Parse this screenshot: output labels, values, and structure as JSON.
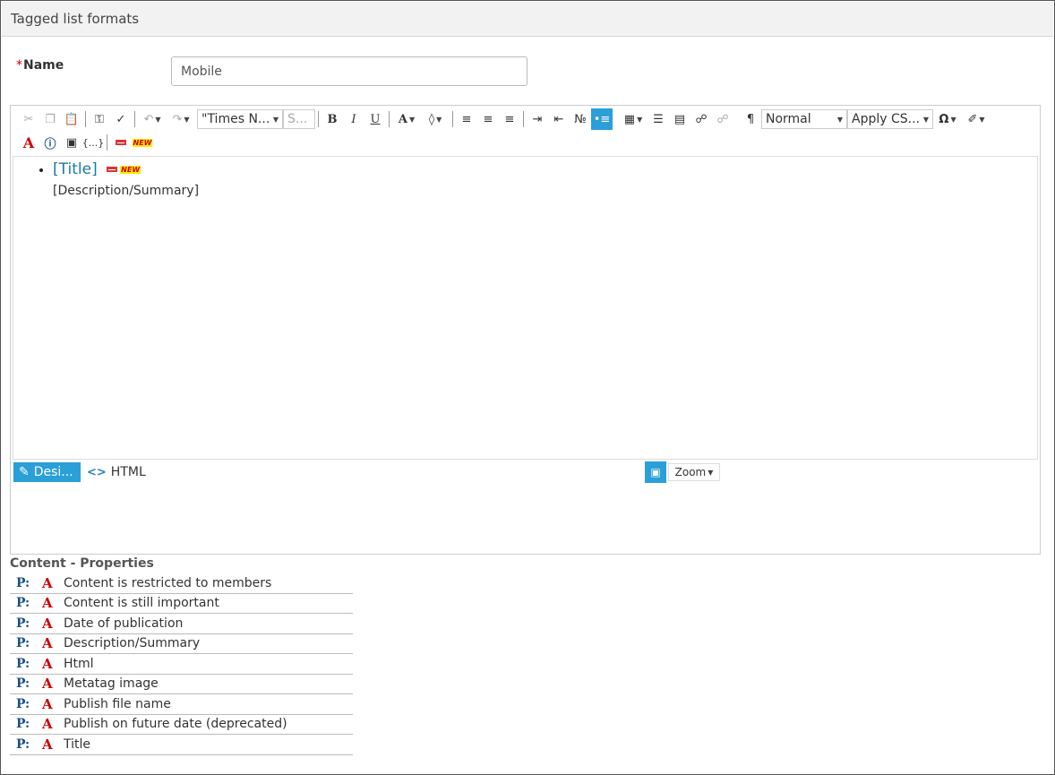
{
  "window": {
    "title": "Tagged list formats"
  },
  "form": {
    "name_required_mark": "*",
    "name_label": "Name",
    "name_value": "Mobile"
  },
  "toolbar": {
    "font_name": "\"Times N...",
    "font_size": "S...",
    "paragraph_format": "Normal",
    "css_class": "Apply CS...",
    "code_macro": "{...}",
    "new_badge_text": "NEW"
  },
  "editor": {
    "title_placeholder": "[Title]",
    "description_placeholder": "[Description/Summary]",
    "design_tab": "Desi...",
    "html_tab": "HTML",
    "zoom_label": "Zoom"
  },
  "properties": {
    "heading": "Content - Properties",
    "p_glyph": "P:",
    "a_glyph": "A",
    "items": [
      {
        "label": "Content is restricted to members"
      },
      {
        "label": "Content is still important"
      },
      {
        "label": "Date of publication"
      },
      {
        "label": "Description/Summary"
      },
      {
        "label": "Html"
      },
      {
        "label": "Metatag image"
      },
      {
        "label": "Publish file name"
      },
      {
        "label": "Publish on future date (deprecated)"
      },
      {
        "label": "Title"
      }
    ]
  },
  "colors": {
    "accent": "#2a9fd8",
    "link": "#1b7aa3",
    "required": "#cc0000"
  }
}
